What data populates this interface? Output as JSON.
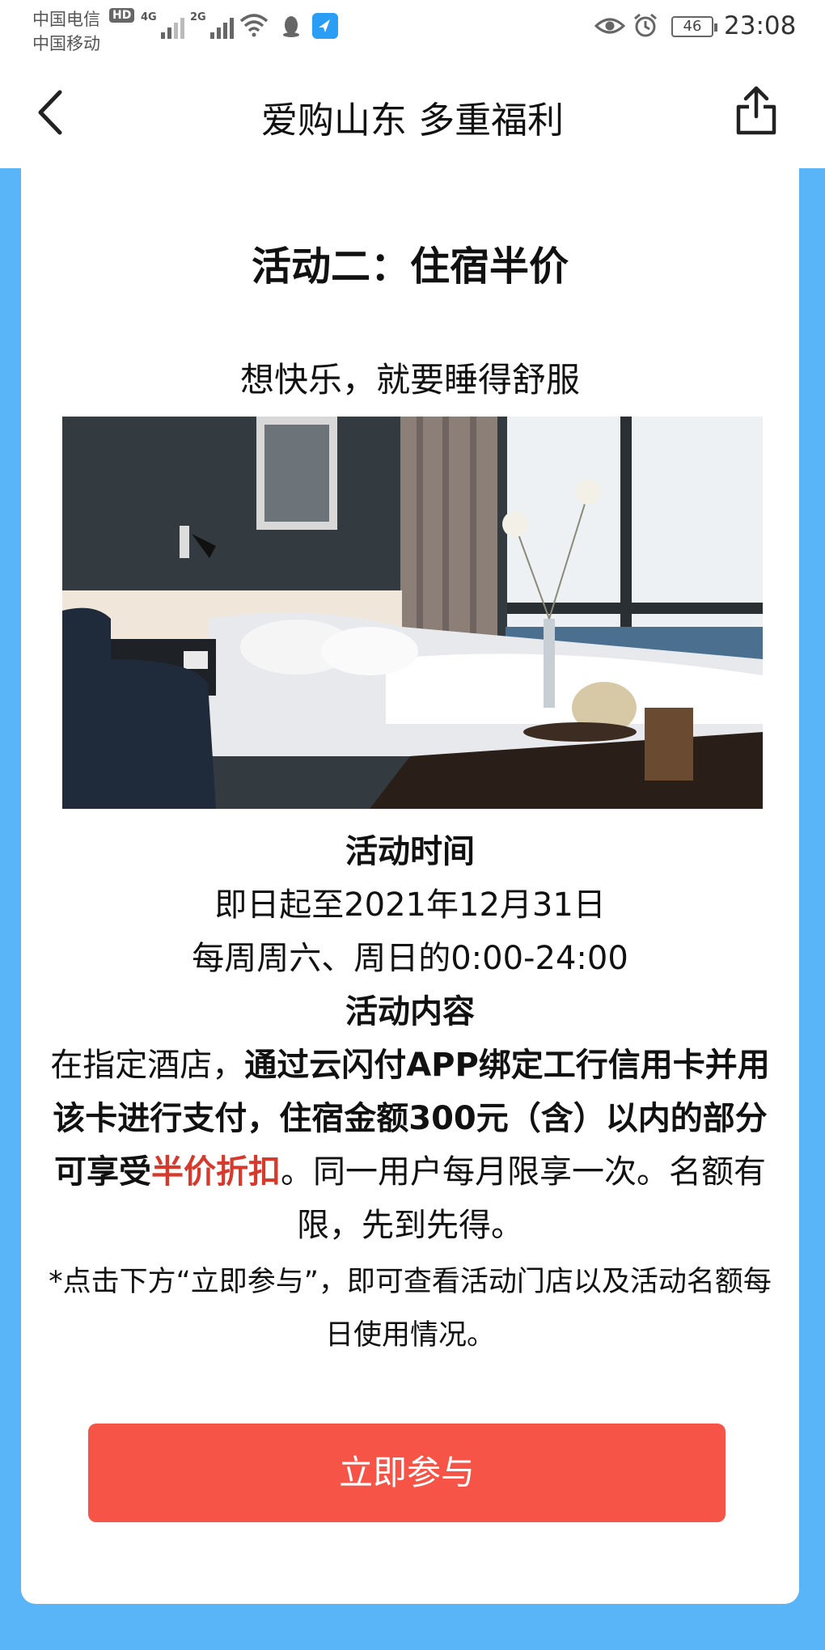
{
  "status_bar": {
    "carrier_1": "中国电信",
    "hd_badge": "HD",
    "carrier_2": "中国移动",
    "network_1": "4G",
    "network_2": "2G",
    "battery": "46",
    "time": "23:08",
    "icons": [
      "wifi-icon",
      "qq-penguin-icon",
      "app-notification-icon",
      "eye-icon",
      "alarm-icon",
      "battery-icon"
    ]
  },
  "nav": {
    "title": "爱购山东 多重福利",
    "back_icon": "chevron-left-icon",
    "share_icon": "share-icon"
  },
  "card": {
    "title": "活动二：住宿半价",
    "subtitle": "想快乐，就要睡得舒服",
    "photo_alt": "hotel-room-photo",
    "time_heading": "活动时间",
    "time_line_1": "即日起至2021年12月31日",
    "time_line_2": "每周周六、周日的0:00-24:00",
    "content_heading": "活动内容",
    "content_part_1": "在指定酒店，",
    "content_bold": "通过云闪付APP绑定工行信用卡并用该卡进行支付，住宿金额300元（含）以内的部分可享受",
    "content_red": "半价折扣",
    "content_part_2": "。同一用户每月限享一次。名额有限，先到先得。",
    "note": "*点击下方“立即参与”，即可查看活动门店以及活动名额每日使用情况。",
    "cta_label": "立即参与"
  },
  "colors": {
    "page_background": "#59b5f7",
    "cta": "#f65447",
    "highlight_red": "#d53a2c"
  }
}
